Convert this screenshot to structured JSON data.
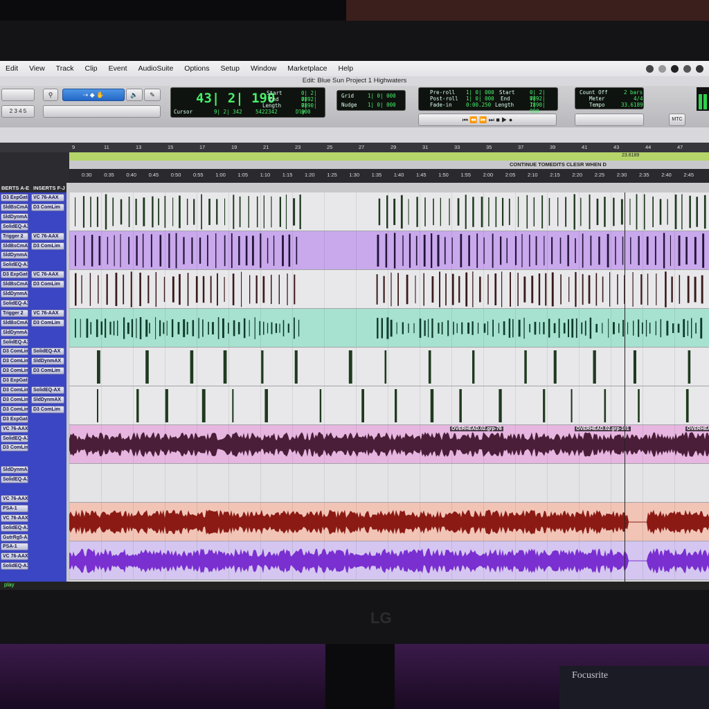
{
  "menubar": {
    "items": [
      "Edit",
      "View",
      "Track",
      "Clip",
      "Event",
      "AudioSuite",
      "Options",
      "Setup",
      "Window",
      "Marketplace",
      "Help"
    ]
  },
  "window_title": "Edit: Blue Sun Project 1 Highwaters",
  "counter": {
    "main": "43| 2| 190",
    "cursor_label": "Cursor",
    "cursor_value": "9| 2| 342",
    "sample_value": "5422342",
    "dly_label": "Dly",
    "start_label": "Start",
    "end_label": "End",
    "length_label": "Length",
    "start_value": "0| 2| 789",
    "end_value": "0| 2| 789",
    "length_value": "0| 0| 000"
  },
  "grid": {
    "grid_label": "Grid",
    "grid_value": "1| 0| 000",
    "nudge_label": "Nudge",
    "nudge_value": "1| 0| 000"
  },
  "transport_counter": {
    "preroll_label": "Pre-roll",
    "postroll_label": "Post-roll",
    "fadein_label": "Fade-in",
    "preroll_value": "1| 0| 000",
    "postroll_value": "1| 0| 000",
    "fadein_value": "0:00.250",
    "start_label": "Start",
    "end_label": "End",
    "length_label": "Length",
    "start_value": "0| 2| 789",
    "end_value": "0| 2| 789",
    "length_value": "1| 0| 000"
  },
  "meter_panel": {
    "countoff_label": "Count Off",
    "countoff_value": "2 bars",
    "meter_label": "Meter",
    "meter_value": "4/4",
    "tempo_label": "Tempo",
    "tempo_value": "33.6189"
  },
  "mtc_label": "MTC",
  "bar_ruler": [
    "9",
    "11",
    "13",
    "15",
    "17",
    "19",
    "21",
    "23",
    "25",
    "27",
    "29",
    "31",
    "33",
    "35",
    "37",
    "39",
    "41",
    "43",
    "44",
    "47"
  ],
  "tempo_marker": "23.6189",
  "marker_text": "CONTINUE TOMEDITS CLESR WHEN D",
  "time_ruler": [
    "0:30",
    "0:35",
    "0:40",
    "0:45",
    "0:50",
    "0:55",
    "1:00",
    "1:05",
    "1:10",
    "1:15",
    "1:20",
    "1:25",
    "1:30",
    "1:35",
    "1:40",
    "1:45",
    "1:50",
    "1:55",
    "2:00",
    "2:05",
    "2:10",
    "2:15",
    "2:20",
    "2:25",
    "2:30",
    "2:35",
    "2:40",
    "2:45"
  ],
  "inserts_header": {
    "a_e": "BERTS A-E",
    "f_j": "INSERTS F-J"
  },
  "inserts": [
    [
      "D3 ExpGate",
      "VC 76-AAX"
    ],
    [
      "SldBsCmAX",
      "D3 ComLim"
    ],
    [
      "SldDynmAX",
      ""
    ],
    [
      "SolidEQ-AX",
      ""
    ],
    [
      "Trigger 2",
      "VC 76-AAX"
    ],
    [
      "SldBsCmAX",
      "D3 ComLim"
    ],
    [
      "SldDynmAX",
      ""
    ],
    [
      "SolidEQ-AX",
      ""
    ],
    [
      "D3 ExpGate",
      "VC 76-AAX"
    ],
    [
      "SldBsCmAX",
      "D3 ComLim"
    ],
    [
      "SldDynmAX",
      ""
    ],
    [
      "SolidEQ-AX",
      ""
    ],
    [
      "Trigger 2",
      "VC 76-AAX"
    ],
    [
      "SldBsCmAX",
      "D3 ComLim"
    ],
    [
      "SldDynmAX",
      ""
    ],
    [
      "SolidEQ-AX",
      ""
    ],
    [
      "D3 ComLim",
      "SolidEQ-AX"
    ],
    [
      "D3 ComLim",
      "SldDynmAX"
    ],
    [
      "D3 ComLim",
      "D3 ComLim"
    ],
    [
      "D3 ExpGate",
      ""
    ],
    [
      "D3 ComLim",
      "SolidEQ-AX"
    ],
    [
      "D3 ComLim",
      "SldDynmAX"
    ],
    [
      "D3 ComLim",
      "D3 ComLim"
    ],
    [
      "D3 ExpGate",
      ""
    ],
    [
      "VC 76-AAX",
      ""
    ],
    [
      "SolidEQ-AX",
      ""
    ],
    [
      "D3 ComLim",
      ""
    ],
    [
      "",
      ""
    ],
    [
      "SldDynmAX",
      ""
    ],
    [
      "SolidEQ-AX",
      ""
    ],
    [
      "",
      ""
    ],
    [
      "VC 76-AAX",
      ""
    ],
    [
      "PSA-1",
      ""
    ],
    [
      "VC 76-AAX",
      ""
    ],
    [
      "SolidEQ-AX",
      ""
    ],
    [
      "GutrRg5-AX",
      ""
    ],
    [
      "PSA-1",
      ""
    ],
    [
      "VC 76-AAX",
      ""
    ],
    [
      "SolidEQ-AX",
      ""
    ],
    [
      "",
      ""
    ]
  ],
  "clip_names": [
    "OVERHEAD.02.grp-76",
    "OVERHEAD.02.grp-101",
    "OVERHEA"
  ],
  "status": "play",
  "brand_monitor": "LG",
  "brand_interface": "Focusrite",
  "colors": {
    "inserts_bg": "#3b46c4",
    "kick_lane": "#e8e8ea",
    "snare_lane": "#c9a8ec",
    "tom_lane": "#e8e8ea",
    "hat_lane": "#a6e2cf",
    "overhead_lane": "#e6b6e0",
    "guitar_lane_1": "#f1c4b6",
    "guitar_lane_2": "#d4c6f0",
    "kick_wave": "#1f3a1f",
    "snare_wave": "#22143a",
    "tom_wave": "#3a1a1a",
    "hat_wave": "#0f3a2a",
    "overhead_wave": "#4a1e38",
    "guitar_wave_1": "#8b1a14",
    "guitar_wave_2": "#7a2fd0"
  }
}
